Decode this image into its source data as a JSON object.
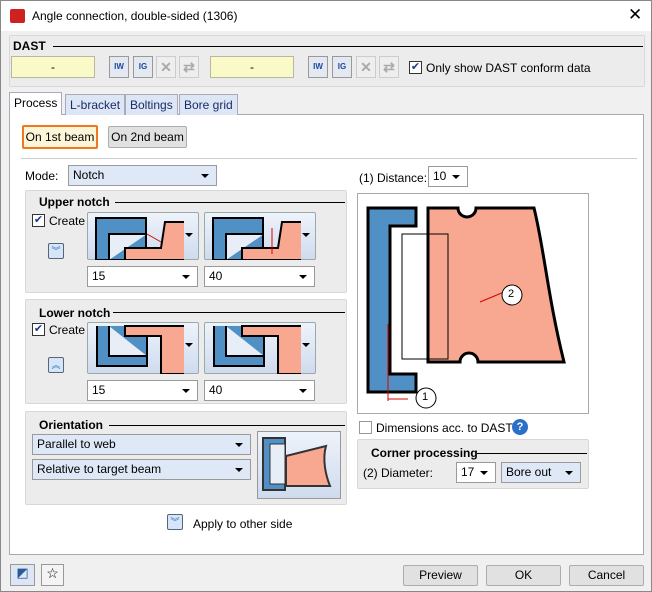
{
  "title": "Angle connection, double-sided (1306)",
  "dast": {
    "label": "DAST",
    "field1": "-",
    "field2": "-",
    "iw": "IW",
    "ig": "IG",
    "only_conform": "Only show DAST conform data",
    "only_conform_checked": true
  },
  "tabs": [
    "Process",
    "L-bracket",
    "Boltings",
    "Bore grid"
  ],
  "beam_buttons": [
    "On 1st beam",
    "On 2nd beam"
  ],
  "mode": {
    "label": "Mode:",
    "value": "Notch"
  },
  "upper_notch": {
    "title": "Upper notch",
    "create": "Create",
    "value1": "15",
    "value2": "40"
  },
  "lower_notch": {
    "title": "Lower notch",
    "create": "Create",
    "value1": "15",
    "value2": "40"
  },
  "orientation": {
    "title": "Orientation",
    "option1": "Parallel to web",
    "option2": "Relative to target beam"
  },
  "apply_other_side": "Apply to other side",
  "distance": {
    "label": "(1) Distance:",
    "value": "10"
  },
  "diagram_labels": [
    "1",
    "2"
  ],
  "dimensions_dast": "Dimensions acc. to DAST",
  "corner": {
    "title": "Corner processing",
    "diameter_label": "(2) Diameter:",
    "diameter": "17",
    "method": "Bore out"
  },
  "footer": {
    "preview": "Preview",
    "ok": "OK",
    "cancel": "Cancel"
  },
  "colors": {
    "blue": "#5090c4",
    "salmon": "#f8a890",
    "accent_orange": "#f07820"
  }
}
